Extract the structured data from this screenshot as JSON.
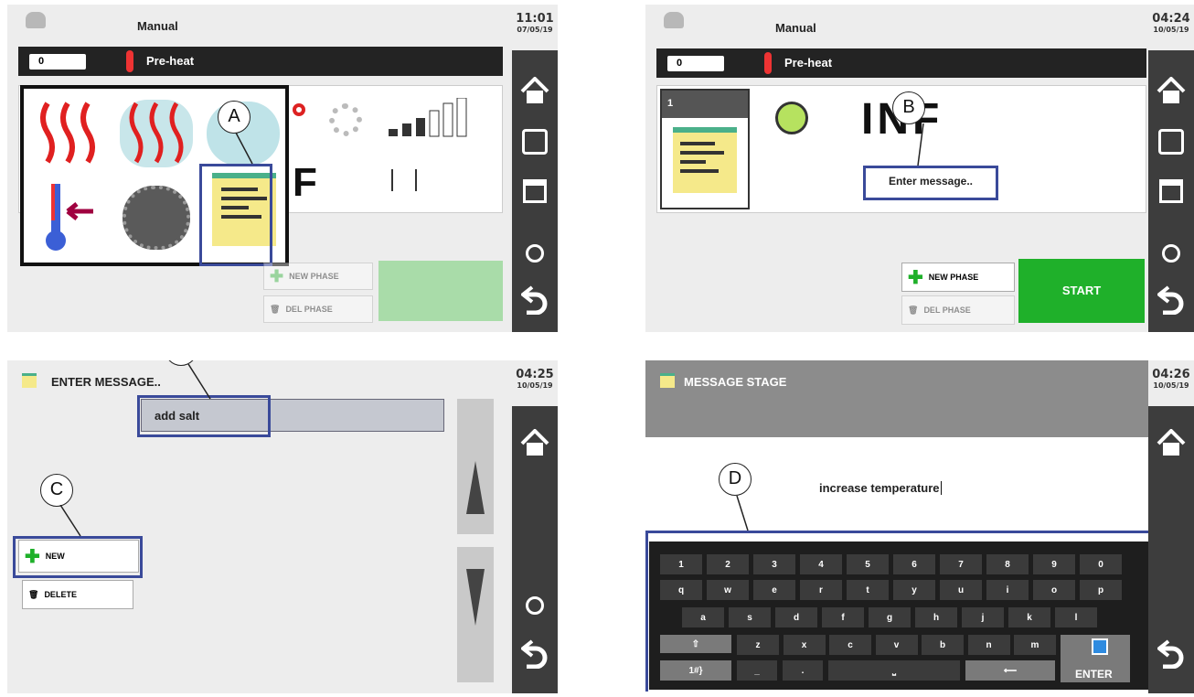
{
  "panel_a": {
    "title": "Manual",
    "time": "11:01",
    "date": "07/05/19",
    "info_value": "0",
    "info_label": "Pre-heat",
    "partial_letter": "F",
    "new_phase": "NEW PHASE",
    "del_phase": "DEL PHASE",
    "callout": "A"
  },
  "panel_b": {
    "title": "Manual",
    "time": "04:24",
    "date": "10/05/19",
    "info_value": "0",
    "info_label": "Pre-heat",
    "phase_number": "1",
    "inf_text": "INF",
    "message": "Enter message..",
    "new_phase": "NEW PHASE",
    "del_phase": "DEL PHASE",
    "start": "START",
    "callout": "B"
  },
  "panel_c": {
    "title": "ENTER MESSAGE..",
    "time": "04:25",
    "date": "10/05/19",
    "list_item": "add salt",
    "new": "NEW",
    "delete": "DELETE",
    "callout_top": "C",
    "callout_left": "C"
  },
  "panel_d": {
    "title": "MESSAGE STAGE",
    "time": "04:26",
    "date": "10/05/19",
    "input_text": "increase temperature",
    "callout": "D",
    "keyboard": {
      "row1": [
        "1",
        "2",
        "3",
        "4",
        "5",
        "6",
        "7",
        "8",
        "9",
        "0"
      ],
      "row2": [
        "q",
        "w",
        "e",
        "r",
        "t",
        "y",
        "u",
        "i",
        "o",
        "p"
      ],
      "row3": [
        "a",
        "s",
        "d",
        "f",
        "g",
        "h",
        "j",
        "k",
        "l"
      ],
      "row4": [
        "z",
        "x",
        "c",
        "v",
        "b",
        "n",
        "m"
      ],
      "sym_key": "1#}",
      "underscore": "_",
      "dot": ".",
      "enter": "ENTER"
    }
  },
  "colors": {
    "sidebar": "#3d3d3d",
    "start_green": "#1fb02a",
    "highlight": "#3a4a9a"
  }
}
